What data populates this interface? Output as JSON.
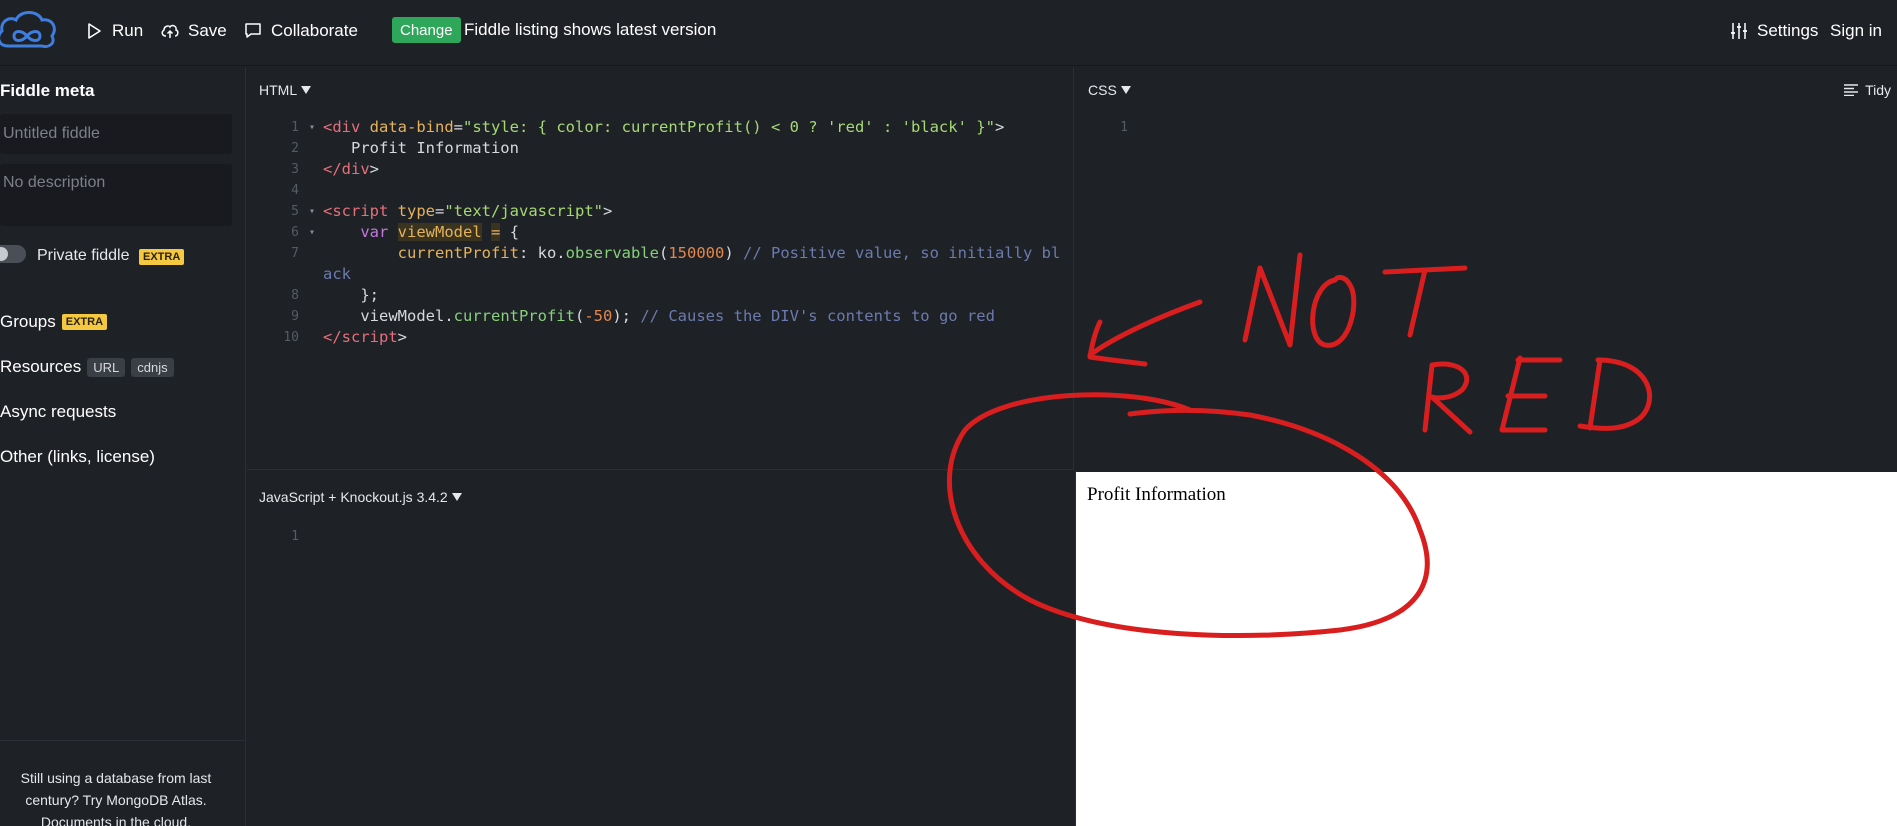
{
  "toolbar": {
    "run_label": "Run",
    "save_label": "Save",
    "collaborate_label": "Collaborate",
    "change_badge": "Change",
    "notice": "Fiddle listing shows latest version",
    "settings_label": "Settings",
    "signin_label": "Sign in"
  },
  "sidebar": {
    "title": "Fiddle meta",
    "title_placeholder": "Untitled fiddle",
    "description_placeholder": "No description",
    "private_label": "Private fiddle",
    "extra_badge": "EXTRA",
    "groups_label": "Groups",
    "resources_label": "Resources",
    "resources_url": "URL",
    "resources_cdnjs": "cdnjs",
    "async_label": "Async requests",
    "other_label": "Other (links, license)",
    "promo": "Still using a database from last century? Try MongoDB Atlas. Documents in the cloud."
  },
  "html_panel": {
    "label": "HTML",
    "line_numbers": [
      "1",
      "2",
      "3",
      "4",
      "5",
      "6",
      "7",
      "",
      "8",
      "9",
      "10"
    ]
  },
  "css_panel": {
    "label": "CSS",
    "tidy_label": "Tidy",
    "line_numbers": [
      "1"
    ]
  },
  "js_panel": {
    "label": "JavaScript + Knockout.js 3.4.2",
    "line_numbers": [
      "1"
    ]
  },
  "result": {
    "text": "Profit Information"
  },
  "annotation": {
    "text_line1": "NOT",
    "text_line2": "RED",
    "color": "#d81e1e"
  },
  "colors": {
    "background": "#1e2126",
    "change_badge": "#2fa75a",
    "extra_badge": "#f5c842"
  }
}
